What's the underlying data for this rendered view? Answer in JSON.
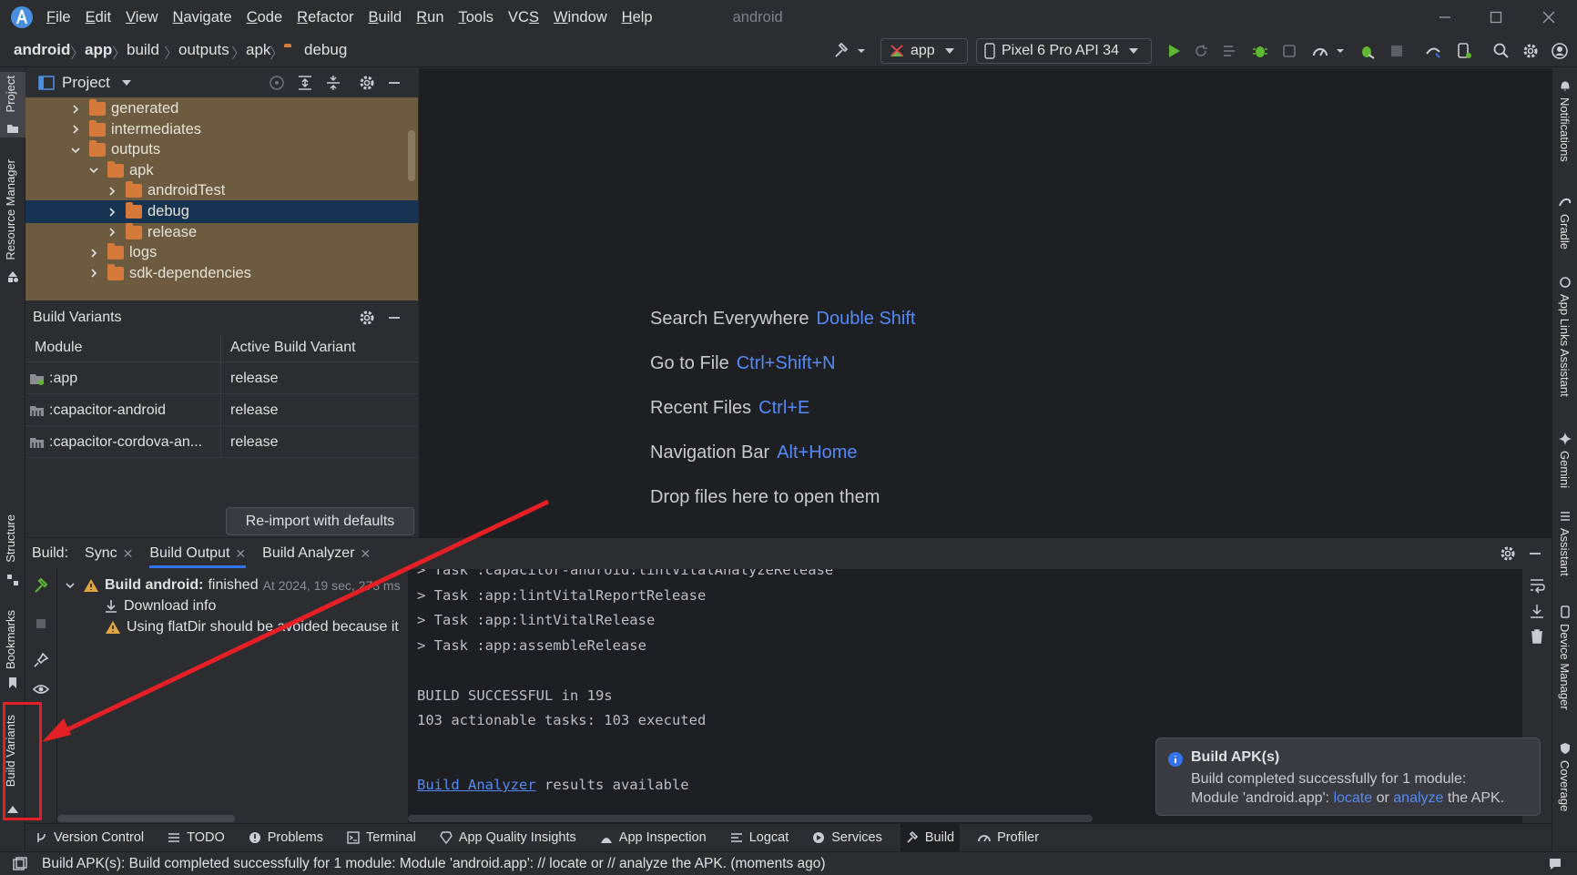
{
  "menubar": {
    "items": [
      {
        "label": "File",
        "u": "F"
      },
      {
        "label": "Edit",
        "u": "E"
      },
      {
        "label": "View",
        "u": "V"
      },
      {
        "label": "Navigate",
        "u": "N"
      },
      {
        "label": "Code",
        "u": "C"
      },
      {
        "label": "Refactor",
        "u": "R"
      },
      {
        "label": "Build",
        "u": "B"
      },
      {
        "label": "Run",
        "u": "R"
      },
      {
        "label": "Tools",
        "u": "T"
      },
      {
        "label": "VCS",
        "u": "S"
      },
      {
        "label": "Window",
        "u": "W"
      },
      {
        "label": "Help",
        "u": "H"
      }
    ],
    "project_name": "android"
  },
  "breadcrumb": {
    "items": [
      "android",
      "app",
      "build",
      "outputs",
      "apk",
      "debug"
    ]
  },
  "toolbar": {
    "run_config": "app",
    "device": "Pixel 6 Pro API 34"
  },
  "left_strip": {
    "project": "Project",
    "resource_manager": "Resource Manager",
    "structure": "Structure",
    "bookmarks": "Bookmarks",
    "build_variants": "Build Variants"
  },
  "right_strip": {
    "notifications": "Notifications",
    "gradle": "Gradle",
    "app_links": "App Links Assistant",
    "gemini": "Gemini",
    "assistant": "Assistant",
    "device_manager": "Device Manager",
    "coverage": "Coverage"
  },
  "project_panel": {
    "title": "Project",
    "tree": [
      {
        "label": "generated",
        "indent": 1,
        "open": false
      },
      {
        "label": "intermediates",
        "indent": 1,
        "open": false
      },
      {
        "label": "outputs",
        "indent": 1,
        "open": true
      },
      {
        "label": "apk",
        "indent": 2,
        "open": true
      },
      {
        "label": "androidTest",
        "indent": 3,
        "open": false
      },
      {
        "label": "debug",
        "indent": 3,
        "open": false,
        "selected": true
      },
      {
        "label": "release",
        "indent": 3,
        "open": false
      },
      {
        "label": "logs",
        "indent": 2,
        "open": false
      },
      {
        "label": "sdk-dependencies",
        "indent": 2,
        "open": false
      }
    ]
  },
  "build_variants": {
    "title": "Build Variants",
    "col_module": "Module",
    "col_variant": "Active Build Variant",
    "rows": [
      {
        "module": ":app",
        "variant": "release"
      },
      {
        "module": ":capacitor-android",
        "variant": "release"
      },
      {
        "module": ":capacitor-cordova-an...",
        "variant": "release"
      }
    ],
    "reimport_label": "Re-import with defaults"
  },
  "welcome": {
    "lines": [
      {
        "text": "Search Everywhere",
        "key": "Double Shift"
      },
      {
        "text": "Go to File",
        "key": "Ctrl+Shift+N"
      },
      {
        "text": "Recent Files",
        "key": "Ctrl+E"
      },
      {
        "text": "Navigation Bar",
        "key": "Alt+Home"
      },
      {
        "text": "Drop files here to open them",
        "key": ""
      }
    ]
  },
  "build_panel": {
    "label": "Build:",
    "tabs": [
      {
        "label": "Sync"
      },
      {
        "label": "Build Output",
        "active": true
      },
      {
        "label": "Build Analyzer"
      }
    ],
    "tree": {
      "root_bold": "Build android:",
      "root_status": "finished",
      "root_time": "At 2024, 19 sec, 273 ms",
      "download": "Download info",
      "warning": "Using flatDir should be avoided because it"
    },
    "console": [
      "> Task :capacitor-android:lintVitalAnalyzeRelease",
      "> Task :app:lintVitalReportRelease",
      "> Task :app:lintVitalRelease",
      "> Task :app:assembleRelease",
      "",
      "BUILD SUCCESSFUL in 19s",
      "103 actionable tasks: 103 executed",
      ""
    ],
    "analyzer_link": "Build Analyzer",
    "analyzer_rest": " results available"
  },
  "notification": {
    "title": "Build APK(s)",
    "line1": "Build completed successfully for 1 module:",
    "line2_pre": "Module 'android.app': ",
    "locate": "locate",
    "or": " or ",
    "analyze": "analyze",
    "line2_post": " the APK."
  },
  "bottom_bar": {
    "items": [
      {
        "label": "Version Control",
        "icon": "branch-icon"
      },
      {
        "label": "TODO",
        "icon": "list-icon"
      },
      {
        "label": "Problems",
        "icon": "alert-icon"
      },
      {
        "label": "Terminal",
        "icon": "terminal-icon"
      },
      {
        "label": "App Quality Insights",
        "icon": "diamond-icon"
      },
      {
        "label": "App Inspection",
        "icon": "inspect-icon"
      },
      {
        "label": "Logcat",
        "icon": "logcat-icon"
      },
      {
        "label": "Services",
        "icon": "play-icon"
      },
      {
        "label": "Build",
        "icon": "hammer-icon",
        "active": true
      },
      {
        "label": "Profiler",
        "icon": "gauge-icon"
      }
    ]
  },
  "status": {
    "text": "Build APK(s): Build completed successfully for 1 module: Module 'android.app': // locate or // analyze the APK. (moments ago)"
  },
  "colors": {
    "accent": "#3574f0",
    "link": "#548af7",
    "annotation": "#e51f26",
    "folder": "#d57a3a",
    "run_green": "#5fb832"
  }
}
